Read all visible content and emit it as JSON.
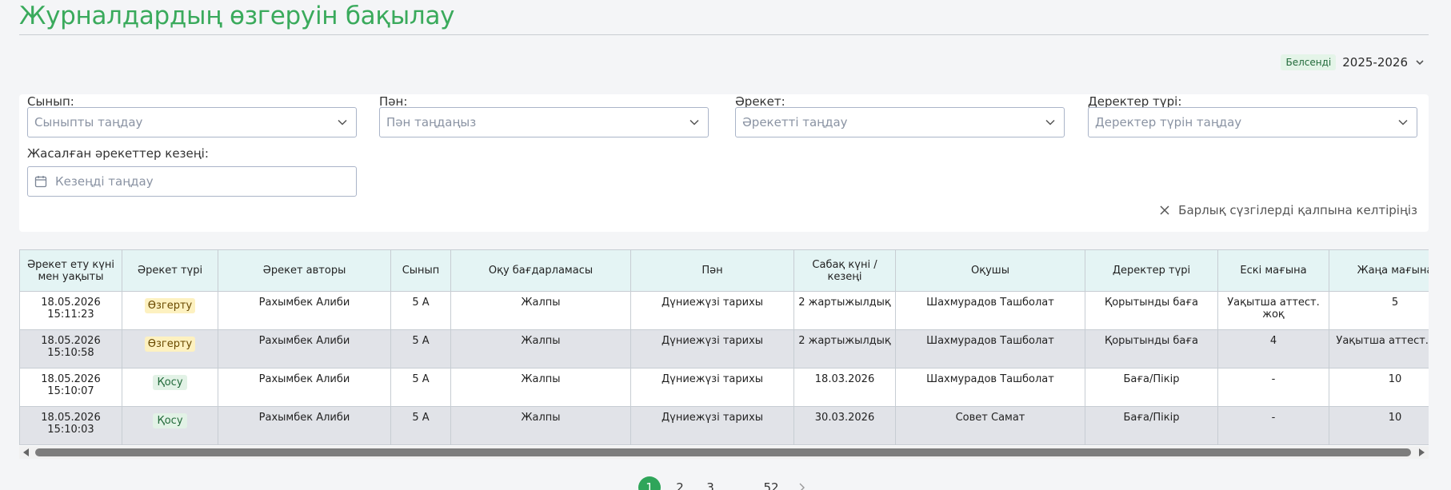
{
  "page": {
    "title": "Журналдардың өзгеруін бақылау",
    "status_badge": "Белсенді",
    "year": "2025-2026"
  },
  "filters": {
    "class": {
      "label": "Сынып:",
      "placeholder": "Сыныпты таңдау"
    },
    "subject": {
      "label": "Пән:",
      "placeholder": "Пән таңдаңыз"
    },
    "action": {
      "label": "Әрекет:",
      "placeholder": "Әрекетті таңдау"
    },
    "data_type": {
      "label": "Деректер түрі:",
      "placeholder": "Деректер түрін таңдау"
    },
    "period": {
      "label": "Жасалған әрекеттер кезеңі:",
      "placeholder": "Кезеңді таңдау"
    },
    "reset_label": "Барлық сүзгілерді қалпына келтіріңіз"
  },
  "table": {
    "headers": [
      "Әрекет ету күні мен уақыты",
      "Әрекет түрі",
      "Әрекет авторы",
      "Сынып",
      "Оқу бағдарламасы",
      "Пән",
      "Сабақ күні / кезеңі",
      "Оқушы",
      "Деректер түрі",
      "Ескі мағына",
      "Жаңа мағына"
    ],
    "rows": [
      {
        "date": "18.05.2026",
        "time": "15:11:23",
        "type": "Өзгерту",
        "type_kind": "change",
        "author": "Рахымбек Алиби",
        "class": "5 А",
        "program": "Жалпы",
        "subject": "Дүниежүзі тарихы",
        "lesson": "2 жартыжылдық",
        "student": "Шахмурадов Ташболат",
        "data_type": "Қорытынды баға",
        "old": "Уақытша аттест. жоқ",
        "new": "5"
      },
      {
        "date": "18.05.2026",
        "time": "15:10:58",
        "type": "Өзгерту",
        "type_kind": "change",
        "author": "Рахымбек Алиби",
        "class": "5 А",
        "program": "Жалпы",
        "subject": "Дүниежүзі тарихы",
        "lesson": "2 жартыжылдық",
        "student": "Шахмурадов Ташболат",
        "data_type": "Қорытынды баға",
        "old": "4",
        "new": "Уақытша аттест. жоқ"
      },
      {
        "date": "18.05.2026",
        "time": "15:10:07",
        "type": "Қосу",
        "type_kind": "add",
        "author": "Рахымбек Алиби",
        "class": "5 А",
        "program": "Жалпы",
        "subject": "Дүниежүзі тарихы",
        "lesson": "18.03.2026",
        "student": "Шахмурадов Ташболат",
        "data_type": "Баға/Пікір",
        "old": "-",
        "new": "10"
      },
      {
        "date": "18.05.2026",
        "time": "15:10:03",
        "type": "Қосу",
        "type_kind": "add",
        "author": "Рахымбек Алиби",
        "class": "5 А",
        "program": "Жалпы",
        "subject": "Дүниежүзі тарихы",
        "lesson": "30.03.2026",
        "student": "Совет Самат",
        "data_type": "Баға/Пікір",
        "old": "-",
        "new": "10"
      }
    ]
  },
  "pagination": {
    "pages": [
      "1",
      "2",
      "3"
    ],
    "ellipsis": "...",
    "last": "52",
    "current": "1"
  },
  "colors": {
    "accent": "#3aaa5c",
    "header_bg": "#e4f4f4",
    "alt_row": "#e1e3e8",
    "change_badge": "#fdf1c0",
    "add_badge": "#e2f2e6"
  },
  "icons": [
    "chevron-down-icon",
    "calendar-icon",
    "close-icon",
    "chevron-right-icon"
  ]
}
